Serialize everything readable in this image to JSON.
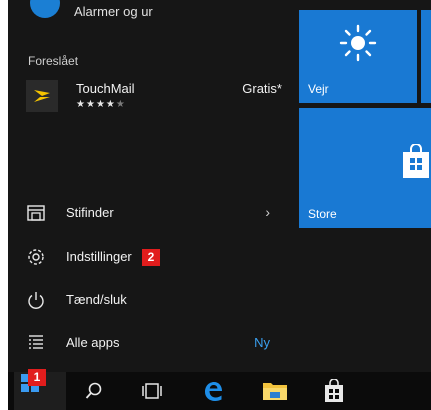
{
  "top_item": {
    "label": "Alarmer og ur"
  },
  "suggested": {
    "section_title": "Foreslået",
    "app_name": "TouchMail",
    "rating": 4,
    "rating_max": 5,
    "price": "Gratis*"
  },
  "menu": {
    "explorer": "Stifinder",
    "settings": "Indstillinger",
    "power": "Tænd/sluk",
    "all_apps": "Alle apps",
    "all_apps_badge": "Ny"
  },
  "badges": {
    "start_marker": "1",
    "settings_marker": "2"
  },
  "tiles": {
    "weather": "Vejr",
    "store": "Store"
  },
  "icons": {
    "explorer": "folder-icon",
    "settings": "gear-icon",
    "power": "power-icon",
    "all_apps": "list-icon",
    "start": "windows-logo-icon",
    "search": "search-icon",
    "task_view": "task-view-icon",
    "edge": "edge-icon",
    "file_explorer": "file-explorer-icon",
    "store": "store-icon"
  },
  "colors": {
    "accent": "#1979d3",
    "panel": "#161616",
    "taskbar": "#0b0b0b",
    "badge": "#e11d1d",
    "link": "#3aa0f0"
  }
}
